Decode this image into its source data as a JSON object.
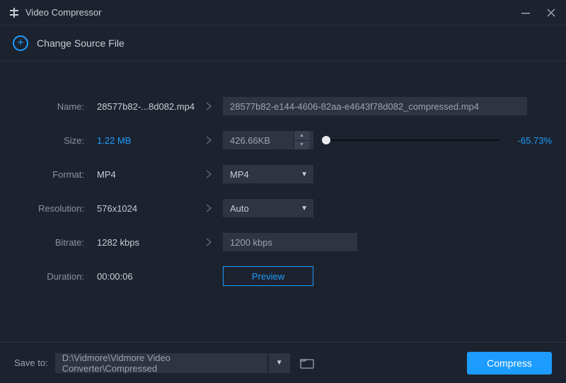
{
  "window": {
    "title": "Video Compressor"
  },
  "change_source": {
    "label": "Change Source File"
  },
  "form": {
    "name": {
      "label": "Name:",
      "orig": "28577b82-...8d082.mp4",
      "output": "28577b82-e144-4606-82aa-e4643f78d082_compressed.mp4"
    },
    "size": {
      "label": "Size:",
      "orig": "1.22 MB",
      "output": "426.66KB",
      "reduction": "-65.73%"
    },
    "format": {
      "label": "Format:",
      "orig": "MP4",
      "selected": "MP4"
    },
    "resolution": {
      "label": "Resolution:",
      "orig": "576x1024",
      "selected": "Auto"
    },
    "bitrate": {
      "label": "Bitrate:",
      "orig": "1282 kbps",
      "output": "1200 kbps"
    },
    "duration": {
      "label": "Duration:",
      "value": "00:00:06"
    },
    "preview": "Preview"
  },
  "footer": {
    "save_label": "Save to:",
    "path": "D:\\Vidmore\\Vidmore Video Converter\\Compressed",
    "compress": "Compress"
  }
}
